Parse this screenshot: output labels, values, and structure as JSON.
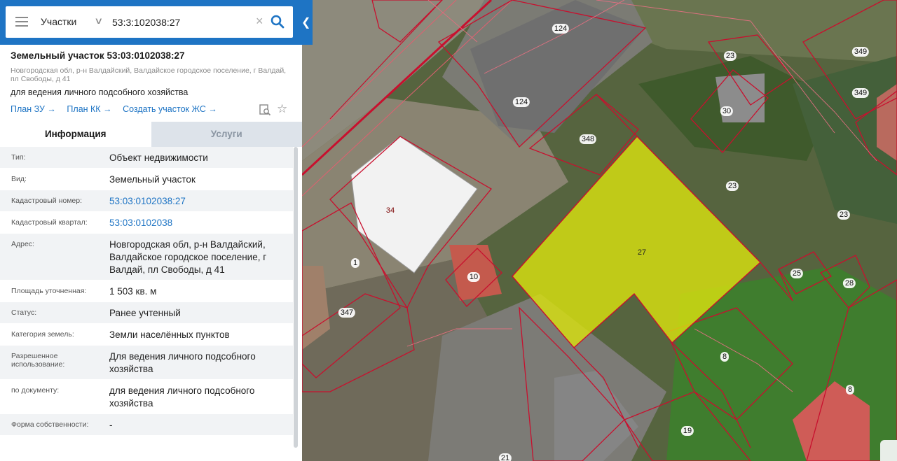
{
  "search": {
    "layer": "Участки",
    "query": "53:3:102038:27",
    "clear_glyph": "×",
    "collapse_glyph": "❮"
  },
  "panel": {
    "title": "Земельный участок 53:03:0102038:27",
    "address": "Новгородская обл, р-н Валдайский, Валдайское городское поселение, г Валдай, пл Свободы, д 41",
    "purpose": "для ведения личного подсобного хозяйства",
    "links": [
      "План ЗУ →",
      "План КК →",
      "Создать участок ЖС →"
    ],
    "tabs": {
      "info": "Информация",
      "services": "Услуги"
    },
    "rows": [
      {
        "key": "Тип:",
        "value": "Объект недвижимости"
      },
      {
        "key": "Вид:",
        "value": "Земельный участок"
      },
      {
        "key": "Кадастровый номер:",
        "value": "53:03:0102038:27"
      },
      {
        "key": "Кадастровый квартал:",
        "value": "53:03:0102038"
      },
      {
        "key": "Адрес:",
        "value": "Новгородская обл, р-н Валдайский, Валдайское городское поселение, г Валдай, пл Свободы, д 41"
      },
      {
        "key": "Площадь уточненная:",
        "value": "1 503 кв. м"
      },
      {
        "key": "Статус:",
        "value": "Ранее учтенный"
      },
      {
        "key": "Категория земель:",
        "value": "Земли населённых пунктов"
      },
      {
        "key": "Разрешенное использование:",
        "value": "Для ведения личного подсобного хозяйства"
      },
      {
        "key": "по документу:",
        "value": "для ведения личного подсобного хозяйства"
      },
      {
        "key": "Форма собственности:",
        "value": "-"
      }
    ]
  },
  "map": {
    "parcel_labels": {
      "selected": "27",
      "l124a": "124",
      "l124b": "124",
      "l23a": "23",
      "l349a": "349",
      "l349b": "349",
      "l30": "30",
      "l348": "348",
      "l23b": "23",
      "l23c": "23",
      "l34": "34",
      "l1": "1",
      "l10": "10",
      "l347": "347",
      "l25": "25",
      "l28": "28",
      "l8a": "8",
      "l8b": "8",
      "l19": "19",
      "l21": "21"
    },
    "colors": {
      "boundary": "#c8102e",
      "selected_fill": "#d8e010",
      "accent": "#1e74c4"
    }
  }
}
